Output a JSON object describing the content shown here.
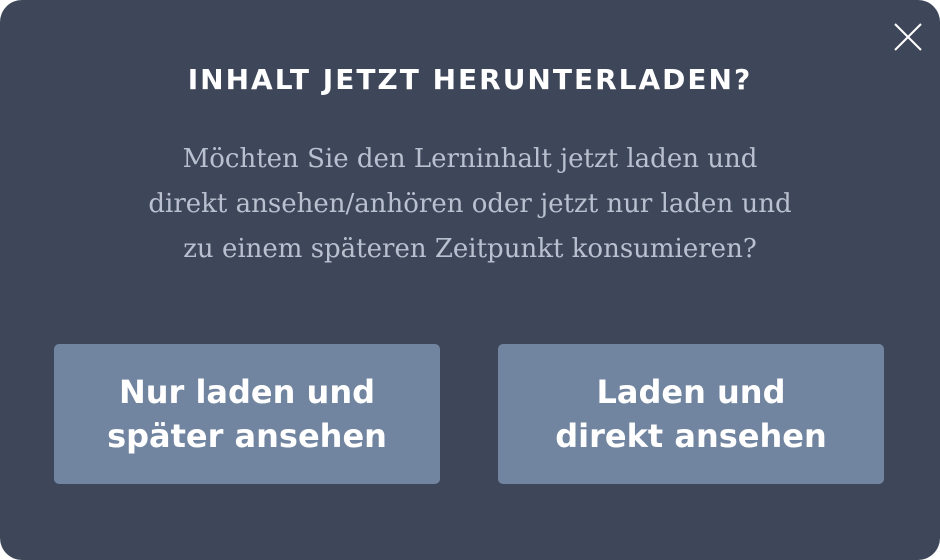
{
  "dialog": {
    "title": "INHALT JETZT HERUNTERLADEN?",
    "message_lines": [
      "Möchten Sie den Lerninhalt jetzt laden und",
      "direkt ansehen/anhören oder jetzt nur laden und",
      "zu einem späteren Zeitpunkt konsumieren?"
    ],
    "close_icon": "close-icon",
    "buttons": [
      {
        "lines": [
          "Nur laden und",
          "später ansehen"
        ]
      },
      {
        "lines": [
          "Laden und",
          "direkt ansehen"
        ]
      }
    ]
  },
  "colors": {
    "dialog_background": "#3e4659",
    "button_background": "#7185a0",
    "title_text": "#ffffff",
    "message_text": "#b9c0cf"
  }
}
